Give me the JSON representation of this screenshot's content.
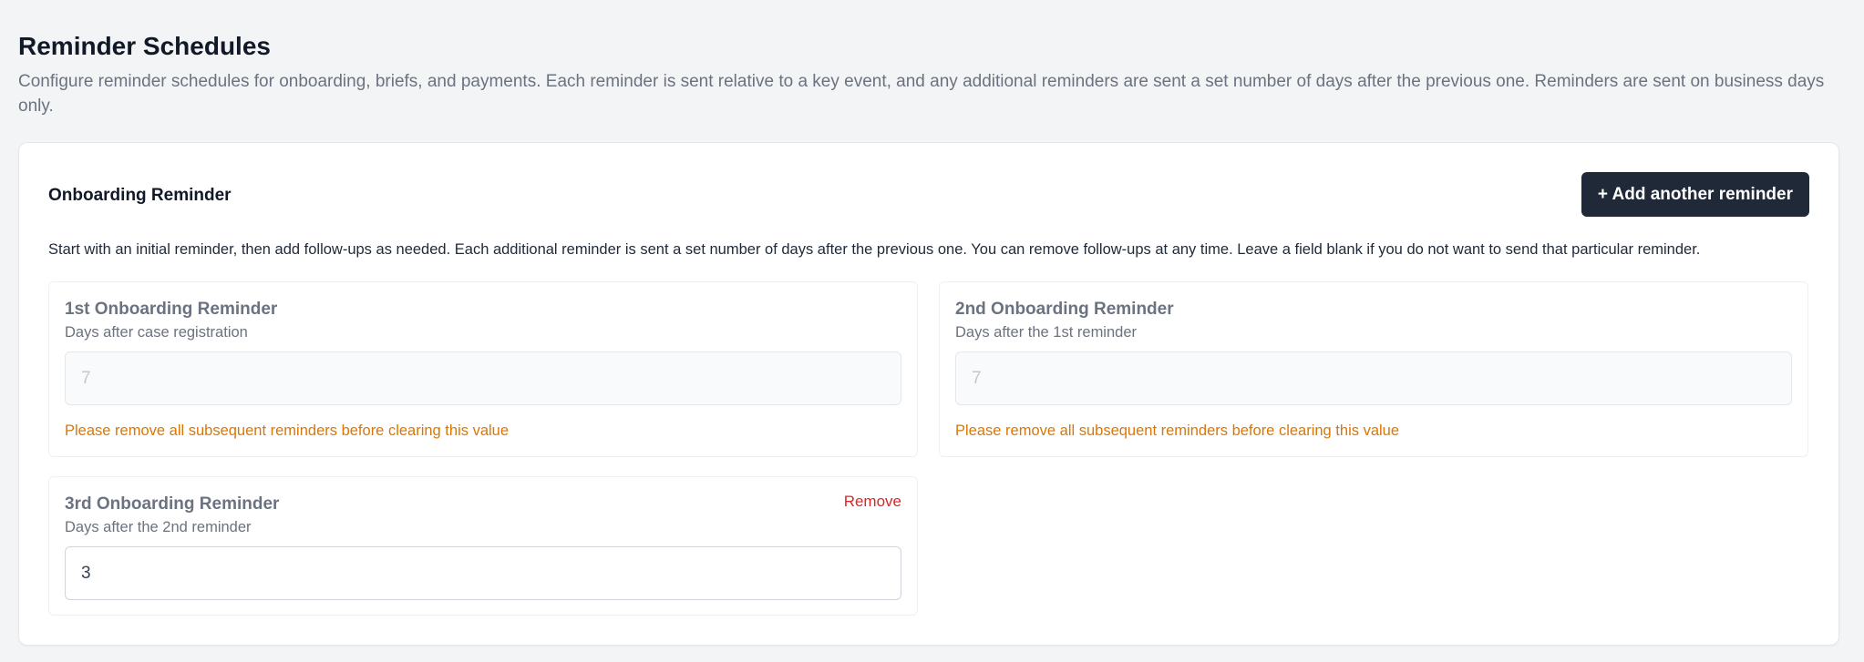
{
  "header": {
    "title": "Reminder Schedules",
    "description": "Configure reminder schedules for onboarding, briefs, and payments. Each reminder is sent relative to a key event, and any additional reminders are sent a set number of days after the previous one. Reminders are sent on business days only."
  },
  "onboarding": {
    "title": "Onboarding Reminder",
    "add_button_label": "+ Add another reminder",
    "description": "Start with an initial reminder, then add follow-ups as needed. Each additional reminder is sent a set number of days after the previous one. You can remove follow-ups at any time. Leave a field blank if you do not want to send that particular reminder.",
    "reminders": [
      {
        "title": "1st Onboarding Reminder",
        "subtitle": "Days after case registration",
        "value": "7",
        "disabled": true,
        "warning": "Please remove all subsequent reminders before clearing this value"
      },
      {
        "title": "2nd Onboarding Reminder",
        "subtitle": "Days after the 1st reminder",
        "value": "7",
        "disabled": true,
        "warning": "Please remove all subsequent reminders before clearing this value"
      },
      {
        "title": "3rd Onboarding Reminder",
        "subtitle": "Days after the 2nd reminder",
        "value": "3",
        "disabled": false,
        "remove_label": "Remove"
      }
    ]
  },
  "colors": {
    "primary_button": "#1f2937",
    "warning_text": "#d97706",
    "remove_text": "#dc2626",
    "page_background": "#f3f4f6"
  }
}
